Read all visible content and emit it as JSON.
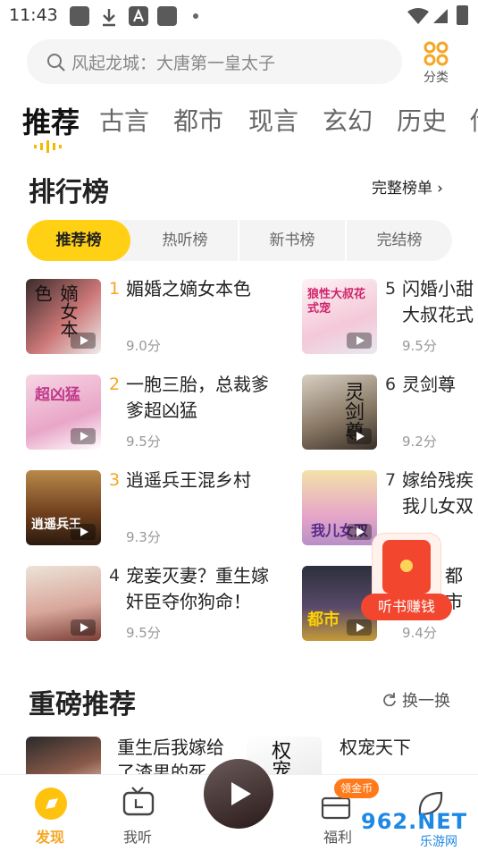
{
  "status_bar": {
    "time": "11:43"
  },
  "search": {
    "placeholder": "风起龙城：大唐第一皇太子",
    "category_label": "分类"
  },
  "tabs": [
    "推荐",
    "古言",
    "都市",
    "现言",
    "玄幻",
    "历史",
    "传"
  ],
  "ranking": {
    "title": "排行榜",
    "more": "完整榜单",
    "segments": [
      "推荐榜",
      "热听榜",
      "新书榜",
      "完结榜"
    ],
    "left": [
      {
        "rank": "1",
        "line1": "媚婚之嫡女本色",
        "line2": "",
        "score": "9.0分"
      },
      {
        "rank": "2",
        "line1": "一胞三胎，总裁爹",
        "line2": "爹超凶猛",
        "score": "9.5分"
      },
      {
        "rank": "3",
        "line1": "逍遥兵王混乡村",
        "line2": "",
        "score": "9.3分"
      },
      {
        "rank": "4",
        "line1": "宠妾灭妻？重生嫁",
        "line2": "奸臣夺你狗命！",
        "score": "9.5分"
      }
    ],
    "right": [
      {
        "rank": "5",
        "line1": "闪婚小甜",
        "line2": "大叔花式",
        "score": "9.5分"
      },
      {
        "rank": "6",
        "line1": "灵剑尊",
        "line2": "",
        "score": "9.2分"
      },
      {
        "rank": "7",
        "line1": "嫁给残疾",
        "line2": "我儿女双",
        "score": ""
      },
      {
        "rank": "",
        "line1": "都市",
        "line2": "",
        "score": "9.4分"
      }
    ],
    "covers_text": {
      "c1": "嫡女本色",
      "c2": "超凶猛",
      "c3": "逍遥兵王",
      "c5": "狼性大叔花式宠",
      "c6": "灵剑尊",
      "c7": "我儿女双",
      "c8": "都市"
    }
  },
  "float_banner": {
    "label": "听书赚钱"
  },
  "featured": {
    "title": "重磅推荐",
    "refresh": "换一换",
    "items": [
      {
        "line1": "重生后我嫁给",
        "line2": "了渣男的死"
      },
      {
        "line1": "权宠天下",
        "line2": ""
      }
    ]
  },
  "bottom_nav": {
    "items": [
      "发现",
      "我听",
      "",
      "福利",
      ""
    ],
    "badge": "领金币",
    "watermark": "962.NET",
    "watermark_sub": "乐游网"
  },
  "colors": {
    "accent": "#ffd014",
    "rank_top": "#f5a623",
    "float_red": "#f2462e"
  }
}
